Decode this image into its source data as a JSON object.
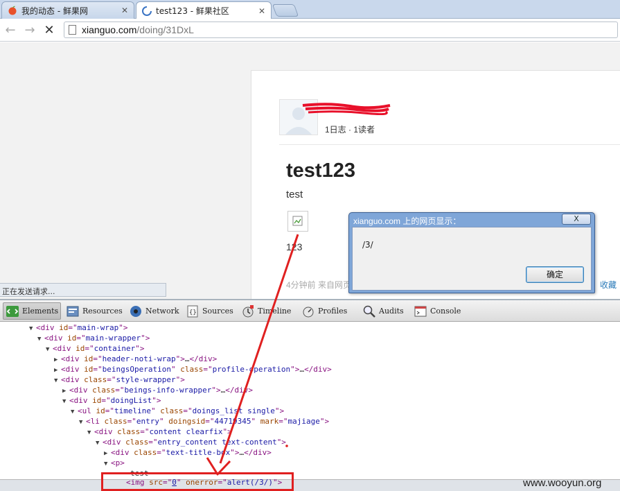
{
  "tabs": [
    {
      "title": "我的动态 - 鲜果网",
      "close": "✕",
      "active": false
    },
    {
      "title": "test123 - 鲜果社区",
      "close": "✕",
      "active": true
    }
  ],
  "address": {
    "host": "xianguo.com",
    "path": "/doing/31DxL"
  },
  "page": {
    "profile_stats": "1日志 · 1读者",
    "post_title": "test123",
    "post_text": "test",
    "post_number": "123",
    "post_meta": "4分钟前 来自网页",
    "collect_link": "收藏"
  },
  "status_bubble": "正在发送请求...",
  "dialog": {
    "title": "xianguo.com 上的网页显示：",
    "close": "X",
    "message": "/3/",
    "ok": "确定"
  },
  "devtools": {
    "tabs": [
      {
        "label": "Elements",
        "icon": "elements-icon"
      },
      {
        "label": "Resources",
        "icon": "resources-icon"
      },
      {
        "label": "Network",
        "icon": "network-icon"
      },
      {
        "label": "Sources",
        "icon": "sources-icon"
      },
      {
        "label": "Timeline",
        "icon": "timeline-icon"
      },
      {
        "label": "Profiles",
        "icon": "profiles-icon"
      },
      {
        "label": "Audits",
        "icon": "audits-icon"
      },
      {
        "label": "Console",
        "icon": "console-icon"
      }
    ],
    "dom_lines": [
      {
        "tri": "▼",
        "parts": [
          [
            "tag",
            "<div "
          ],
          [
            "attr",
            "id"
          ],
          [
            "tag",
            "=\""
          ],
          [
            "val",
            "main-wrap"
          ],
          [
            "tag",
            "\">"
          ]
        ]
      },
      {
        "tri": "▼",
        "parts": [
          [
            "tag",
            "<div "
          ],
          [
            "attr",
            "id"
          ],
          [
            "tag",
            "=\""
          ],
          [
            "val",
            "main-wrapper"
          ],
          [
            "tag",
            "\">"
          ]
        ]
      },
      {
        "tri": "▼",
        "parts": [
          [
            "tag",
            "<div "
          ],
          [
            "attr",
            "id"
          ],
          [
            "tag",
            "=\""
          ],
          [
            "val",
            "container"
          ],
          [
            "tag",
            "\">"
          ]
        ]
      },
      {
        "tri": "▶",
        "parts": [
          [
            "tag",
            "<div "
          ],
          [
            "attr",
            "id"
          ],
          [
            "tag",
            "=\""
          ],
          [
            "val",
            "header-noti-wrap"
          ],
          [
            "tag",
            "\">"
          ],
          [
            "txt",
            "…"
          ],
          [
            "tag",
            "</div>"
          ]
        ]
      },
      {
        "tri": "▶",
        "parts": [
          [
            "tag",
            "<div "
          ],
          [
            "attr",
            "id"
          ],
          [
            "tag",
            "=\""
          ],
          [
            "val",
            "beingsOperation"
          ],
          [
            "tag",
            "\" "
          ],
          [
            "attr",
            "class"
          ],
          [
            "tag",
            "=\""
          ],
          [
            "val",
            "profile-operation"
          ],
          [
            "tag",
            "\">"
          ],
          [
            "txt",
            "…"
          ],
          [
            "tag",
            "</div>"
          ]
        ]
      },
      {
        "tri": "▼",
        "parts": [
          [
            "tag",
            "<div "
          ],
          [
            "attr",
            "class"
          ],
          [
            "tag",
            "=\""
          ],
          [
            "val",
            "style-wrapper"
          ],
          [
            "tag",
            "\">"
          ]
        ]
      },
      {
        "tri": "▶",
        "parts": [
          [
            "tag",
            "<div "
          ],
          [
            "attr",
            "class"
          ],
          [
            "tag",
            "=\""
          ],
          [
            "val",
            "beings-info-wrapper"
          ],
          [
            "tag",
            "\">"
          ],
          [
            "txt",
            "…"
          ],
          [
            "tag",
            "</div>"
          ]
        ]
      },
      {
        "tri": "▼",
        "parts": [
          [
            "tag",
            "<div "
          ],
          [
            "attr",
            "id"
          ],
          [
            "tag",
            "=\""
          ],
          [
            "val",
            "doingList"
          ],
          [
            "tag",
            "\">"
          ]
        ]
      },
      {
        "tri": "▼",
        "parts": [
          [
            "tag",
            "<ul "
          ],
          [
            "attr",
            "id"
          ],
          [
            "tag",
            "=\""
          ],
          [
            "val",
            "timeline"
          ],
          [
            "tag",
            "\" "
          ],
          [
            "attr",
            "class"
          ],
          [
            "tag",
            "=\""
          ],
          [
            "val",
            "doings_list single"
          ],
          [
            "tag",
            "\">"
          ]
        ]
      },
      {
        "tri": "▼",
        "parts": [
          [
            "tag",
            "<li "
          ],
          [
            "attr",
            "class"
          ],
          [
            "tag",
            "=\""
          ],
          [
            "val",
            "entry"
          ],
          [
            "tag",
            "\" "
          ],
          [
            "attr",
            "doingsid"
          ],
          [
            "tag",
            "=\""
          ],
          [
            "val",
            "44719345"
          ],
          [
            "tag",
            "\" "
          ],
          [
            "attr",
            "mark"
          ],
          [
            "tag",
            "=\""
          ],
          [
            "val",
            "majiage"
          ],
          [
            "tag",
            "\">"
          ]
        ]
      },
      {
        "tri": "▼",
        "parts": [
          [
            "tag",
            "<div "
          ],
          [
            "attr",
            "class"
          ],
          [
            "tag",
            "=\""
          ],
          [
            "val",
            "content clearfix"
          ],
          [
            "tag",
            "\">"
          ]
        ]
      },
      {
        "tri": "▼",
        "parts": [
          [
            "tag",
            "<div "
          ],
          [
            "attr",
            "class"
          ],
          [
            "tag",
            "=\""
          ],
          [
            "val",
            "entry_content text-content"
          ],
          [
            "tag",
            "\">"
          ]
        ]
      },
      {
        "tri": "▶",
        "parts": [
          [
            "tag",
            "<div "
          ],
          [
            "attr",
            "class"
          ],
          [
            "tag",
            "=\""
          ],
          [
            "val",
            "text-title-box"
          ],
          [
            "tag",
            "\">"
          ],
          [
            "txt",
            "…"
          ],
          [
            "tag",
            "</div>"
          ]
        ]
      },
      {
        "tri": "▼",
        "parts": [
          [
            "tag",
            "<p>"
          ]
        ]
      },
      {
        "tri": "",
        "parts": [
          [
            "txt",
            "test"
          ]
        ]
      },
      {
        "tri": "",
        "parts": [
          [
            "tag",
            "<img "
          ],
          [
            "attr",
            "src"
          ],
          [
            "tag",
            "=\""
          ],
          [
            "link",
            "0"
          ],
          [
            "tag",
            "\" "
          ],
          [
            "attr",
            "onerror"
          ],
          [
            "tag",
            "=\""
          ],
          [
            "val",
            "alert(/3/)"
          ],
          [
            "tag",
            "\">"
          ]
        ]
      }
    ]
  },
  "watermark": "www.wooyun.org",
  "colors": {
    "annotation_red": "#e02020",
    "link_blue": "#2a7ab8",
    "dialog_frame": "#7fa6d8"
  }
}
